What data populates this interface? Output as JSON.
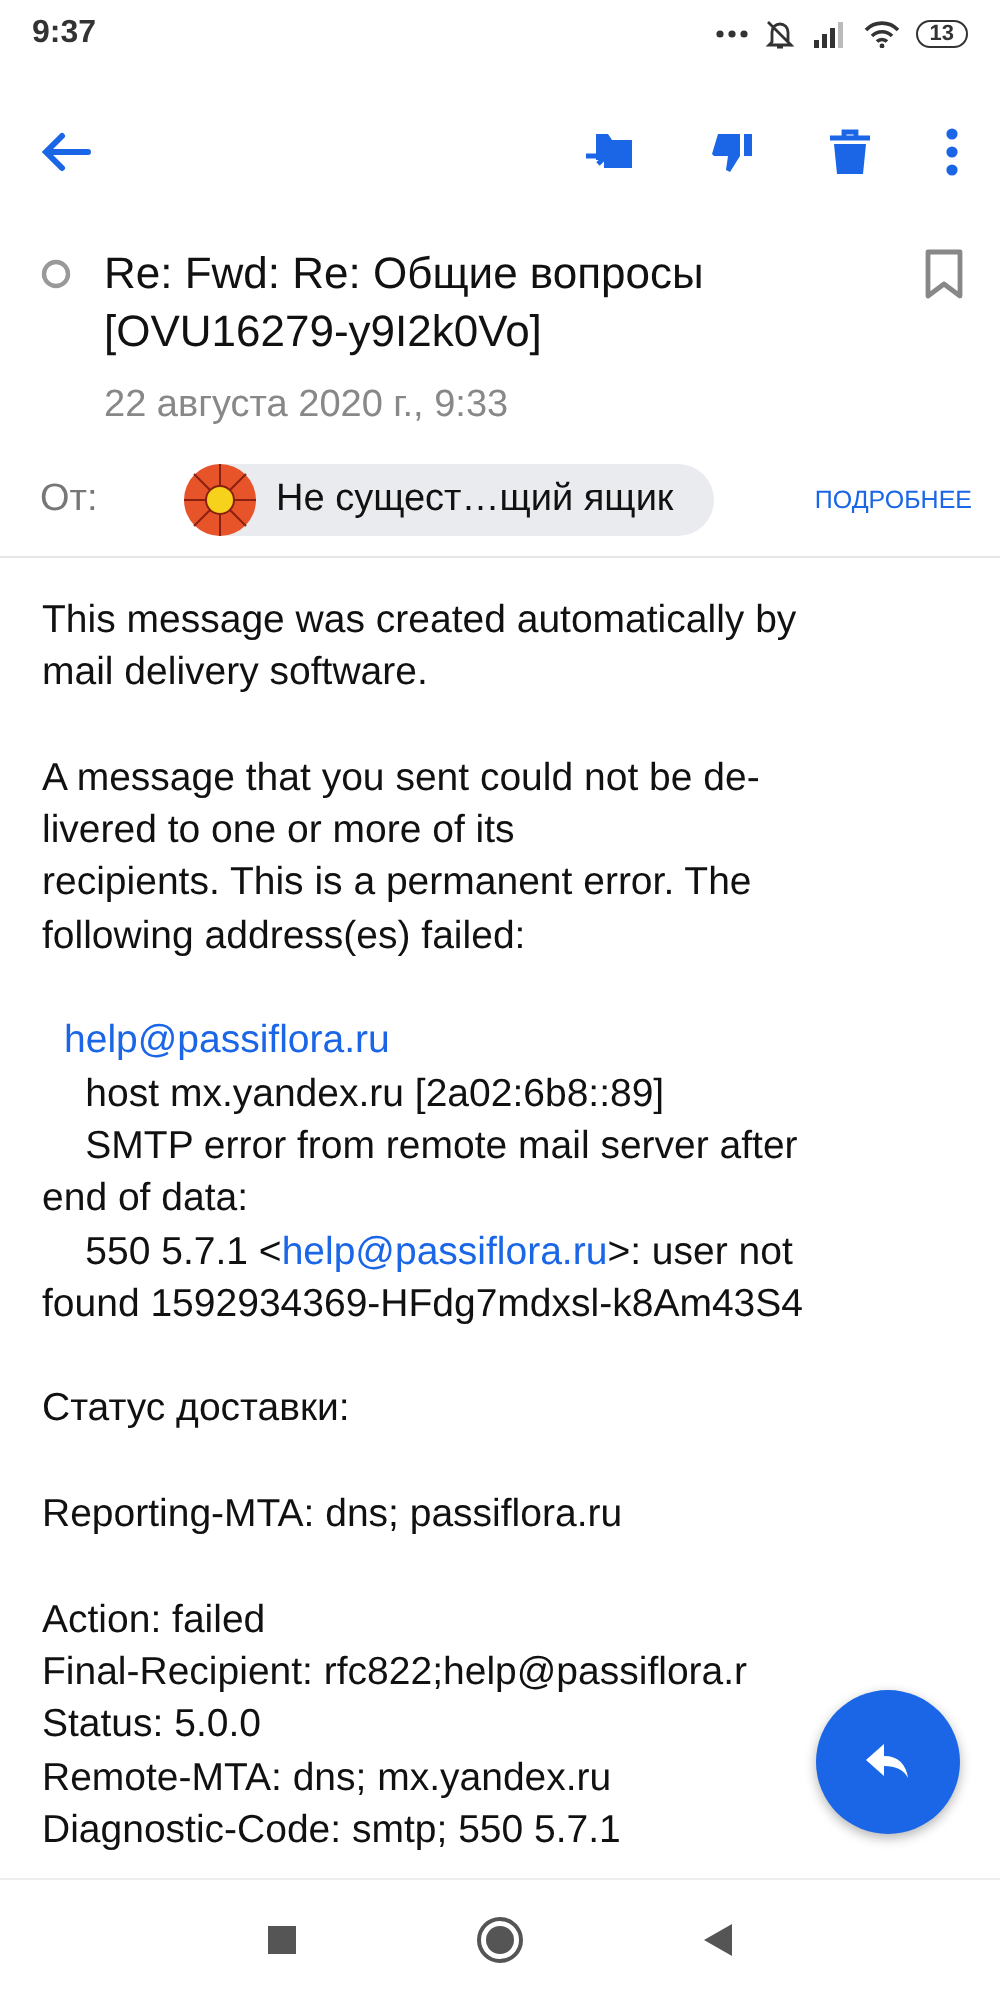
{
  "status_bar": {
    "time": "9:37",
    "battery": "13"
  },
  "message": {
    "subject": "Re: Fwd: Re: Общие вопросы [OVU16279-y9I2k0Vo]",
    "unread": false,
    "bookmarked": false,
    "date": "22 августа 2020 г., 9:33",
    "from_label": "От:",
    "sender": "Не сущест…щий ящик",
    "details_link": "ПОДРОБНЕЕ"
  },
  "body": [
    {
      "lines": [
        [
          {
            "kind": "text",
            "text": "This message was created automatically by"
          }
        ],
        [
          {
            "kind": "text",
            "text": "mail delivery software."
          }
        ]
      ]
    },
    {
      "lines": [
        [
          {
            "kind": "text",
            "text": "A message that you sent could not be de-"
          }
        ],
        [
          {
            "kind": "text",
            "text": "livered to one or more of its"
          }
        ],
        [
          {
            "kind": "text",
            "text": "recipients. This is a permanent error. The"
          }
        ],
        [
          {
            "kind": "text",
            "text": "following address(es) failed:"
          }
        ]
      ]
    },
    {
      "lines": [
        [
          {
            "kind": "link",
            "text": "help@passiflora.ru"
          }
        ],
        [
          {
            "kind": "text",
            "text": "    host mx.yandex.ru [2a02:6b8::89]"
          }
        ],
        [
          {
            "kind": "text",
            "text": "    SMTP error from remote mail server after"
          }
        ],
        [
          {
            "kind": "text",
            "text": "end of data:"
          }
        ],
        [
          {
            "kind": "text",
            "text": "    550 5.7.1 <"
          },
          {
            "kind": "link",
            "text": "help@passiflora.ru"
          },
          {
            "kind": "text",
            "text": ">: user not"
          }
        ],
        [
          {
            "kind": "text",
            "text": "found 1592934369-HFdg7mdxsl-k8Am43S4"
          }
        ]
      ]
    },
    {
      "lines": [
        [
          {
            "kind": "text",
            "text": "Статус доставки:"
          }
        ]
      ]
    },
    {
      "lines": [
        [
          {
            "kind": "text",
            "text": "Reporting-MTA: dns; passiflora.ru"
          }
        ]
      ]
    },
    {
      "lines": [
        [
          {
            "kind": "text",
            "text": "Action: failed"
          }
        ],
        [
          {
            "kind": "text",
            "text": "Final-Recipient: rfc822;help@passiflora.r"
          }
        ],
        [
          {
            "kind": "text",
            "text": "Status: 5.0.0"
          }
        ],
        [
          {
            "kind": "text",
            "text": "Remote-MTA: dns; mx.yandex.ru"
          }
        ],
        [
          {
            "kind": "text",
            "text": "Diagnostic-Code: smtp; 550 5.7.1"
          }
        ]
      ]
    }
  ]
}
